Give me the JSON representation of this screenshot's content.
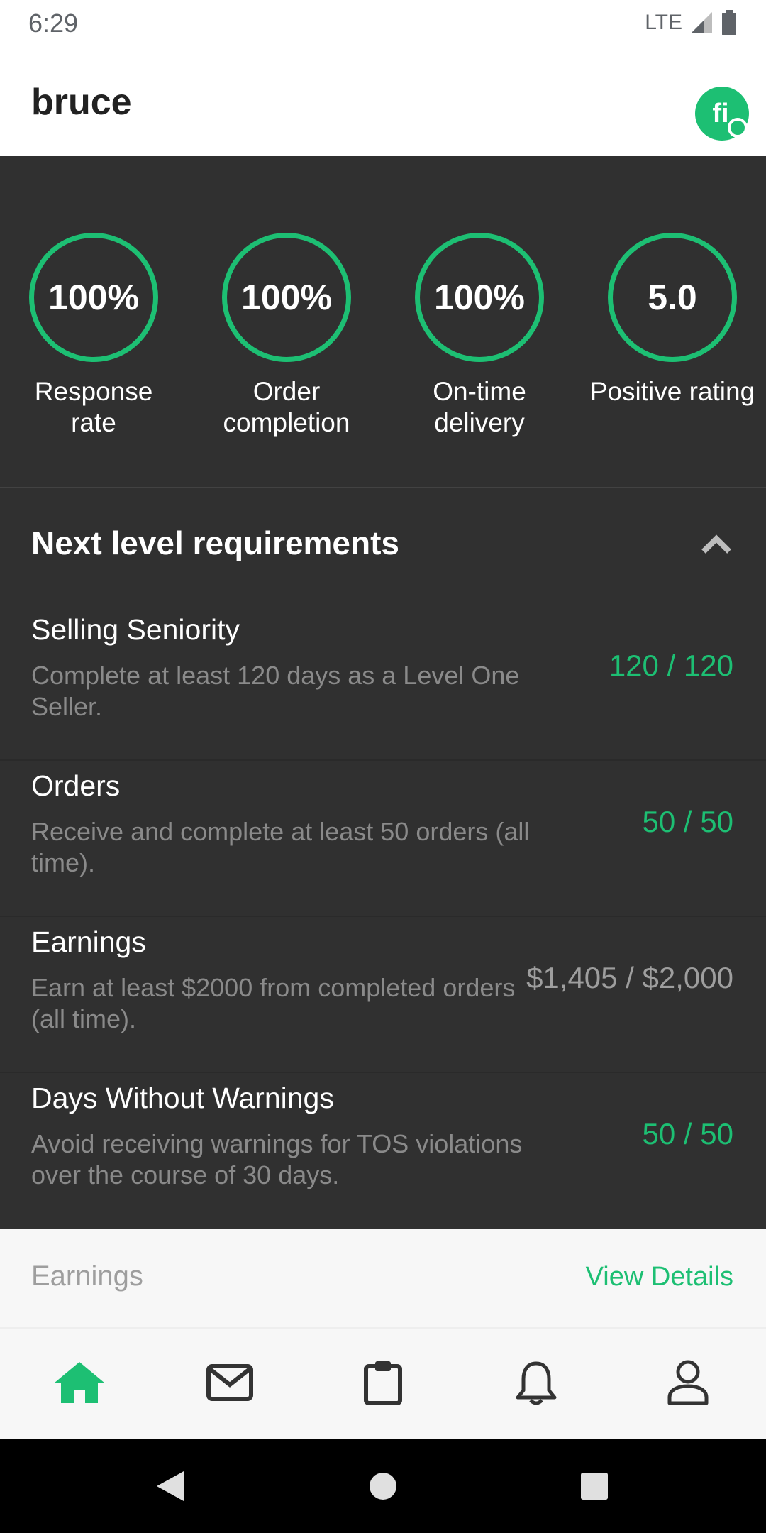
{
  "status_bar": {
    "time": "6:29",
    "network": "LTE"
  },
  "app_bar": {
    "title": "bruce",
    "logo": "fi"
  },
  "stats": [
    {
      "value": "100%",
      "label": "Response rate"
    },
    {
      "value": "100%",
      "label": "Order completion"
    },
    {
      "value": "100%",
      "label": "On-time delivery"
    },
    {
      "value": "5.0",
      "label": "Positive rating"
    }
  ],
  "requirements": {
    "title": "Next level requirements",
    "items": [
      {
        "name": "Selling Seniority",
        "description": "Complete at least 120 days as a Level One Seller.",
        "progress": "120 / 120",
        "complete": true
      },
      {
        "name": "Orders",
        "description": "Receive and complete at least 50 orders (all time).",
        "progress": "50 / 50",
        "complete": true
      },
      {
        "name": "Earnings",
        "description": "Earn at least $2000 from completed orders (all time).",
        "progress": "$1,405 / $2,000",
        "complete": false
      },
      {
        "name": "Days Without Warnings",
        "description": "Avoid receiving warnings for TOS violations over the course of 30 days.",
        "progress": "50 / 50",
        "complete": true
      }
    ]
  },
  "earnings_section": {
    "label": "Earnings",
    "link": "View Details"
  },
  "bottom_nav": [
    {
      "icon": "home-icon",
      "active": true
    },
    {
      "icon": "mail-icon",
      "active": false
    },
    {
      "icon": "clipboard-icon",
      "active": false
    },
    {
      "icon": "bell-icon",
      "active": false
    },
    {
      "icon": "profile-icon",
      "active": false
    }
  ],
  "colors": {
    "accent": "#1dbf73",
    "dark_bg": "#303030",
    "muted": "#8a8a8a"
  }
}
